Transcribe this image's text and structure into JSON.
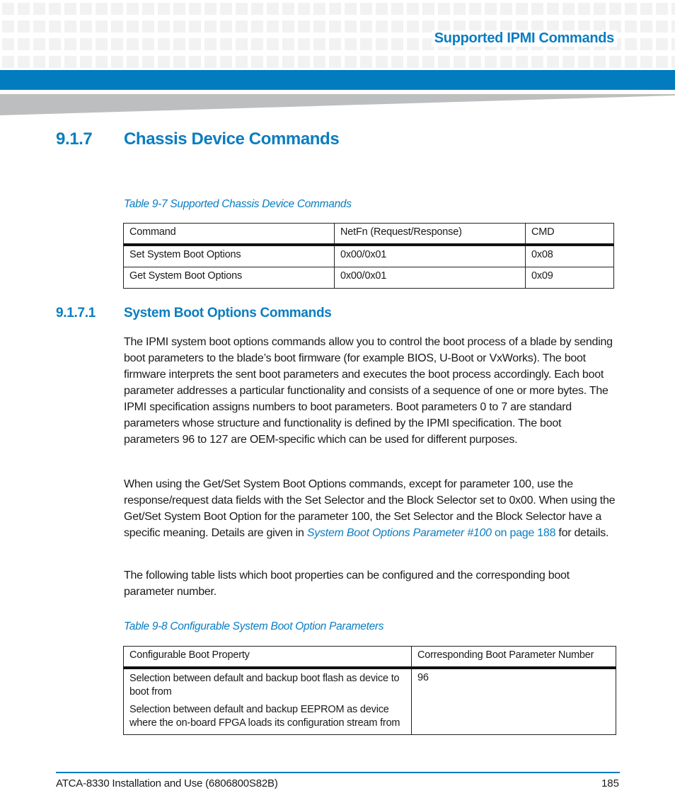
{
  "header": {
    "section_title": "Supported IPMI Commands",
    "accent_color": "#027bbf"
  },
  "section": {
    "number": "9.1.7",
    "title": "Chassis Device Commands"
  },
  "table1": {
    "caption": "Table 9-7 Supported Chassis Device Commands",
    "columns": [
      "Command",
      "NetFn (Request/Response)",
      "CMD"
    ],
    "rows": [
      [
        "Set System Boot Options",
        "0x00/0x01",
        "0x08"
      ],
      [
        "Get System Boot Options",
        "0x00/0x01",
        "0x09"
      ]
    ]
  },
  "subsection": {
    "number": "9.1.7.1",
    "title": "System Boot Options Commands"
  },
  "paragraphs": {
    "p1": "The IPMI system boot options commands allow you to control the boot process of a blade by sending boot parameters to the blade’s boot firmware (for example BIOS, U-Boot or VxWorks). The boot firmware interprets the sent boot parameters and executes the boot process accordingly. Each boot parameter addresses a particular functionality and consists of a sequence of one or more bytes. The IPMI specification assigns numbers to boot parameters. Boot parameters 0 to 7 are standard parameters whose structure and functionality is defined by the IPMI specification. The boot parameters 96 to 127 are OEM-specific which can be used for different purposes.",
    "p2_before_link": "When using the Get/Set System Boot Options commands, except for parameter 100, use the response/request data fields with the Set Selector and the Block Selector set to 0x00. When using the Get/Set System Boot Option for the parameter 100, the Set Selector and the Block Selector have a specific meaning. Details are given in ",
    "p2_link_italic": "System Boot Options Parameter #100",
    "p2_link_page": " on page 188",
    "p2_after_link": " for details.",
    "p3": "The following table lists which boot properties can be configured and the corresponding boot parameter number."
  },
  "table2": {
    "caption": "Table 9-8 Configurable System Boot Option Parameters",
    "columns": [
      "Configurable Boot Property",
      "Corresponding Boot Parameter Number"
    ],
    "rows": [
      {
        "properties": [
          "Selection between default and backup boot flash as device to boot from",
          "Selection between default and backup EEPROM as device where the on-board FPGA loads its configuration stream from"
        ],
        "number": "96"
      }
    ]
  },
  "footer": {
    "document": "ATCA-8330 Installation and Use (6806800S82B)",
    "page_number": "185"
  }
}
